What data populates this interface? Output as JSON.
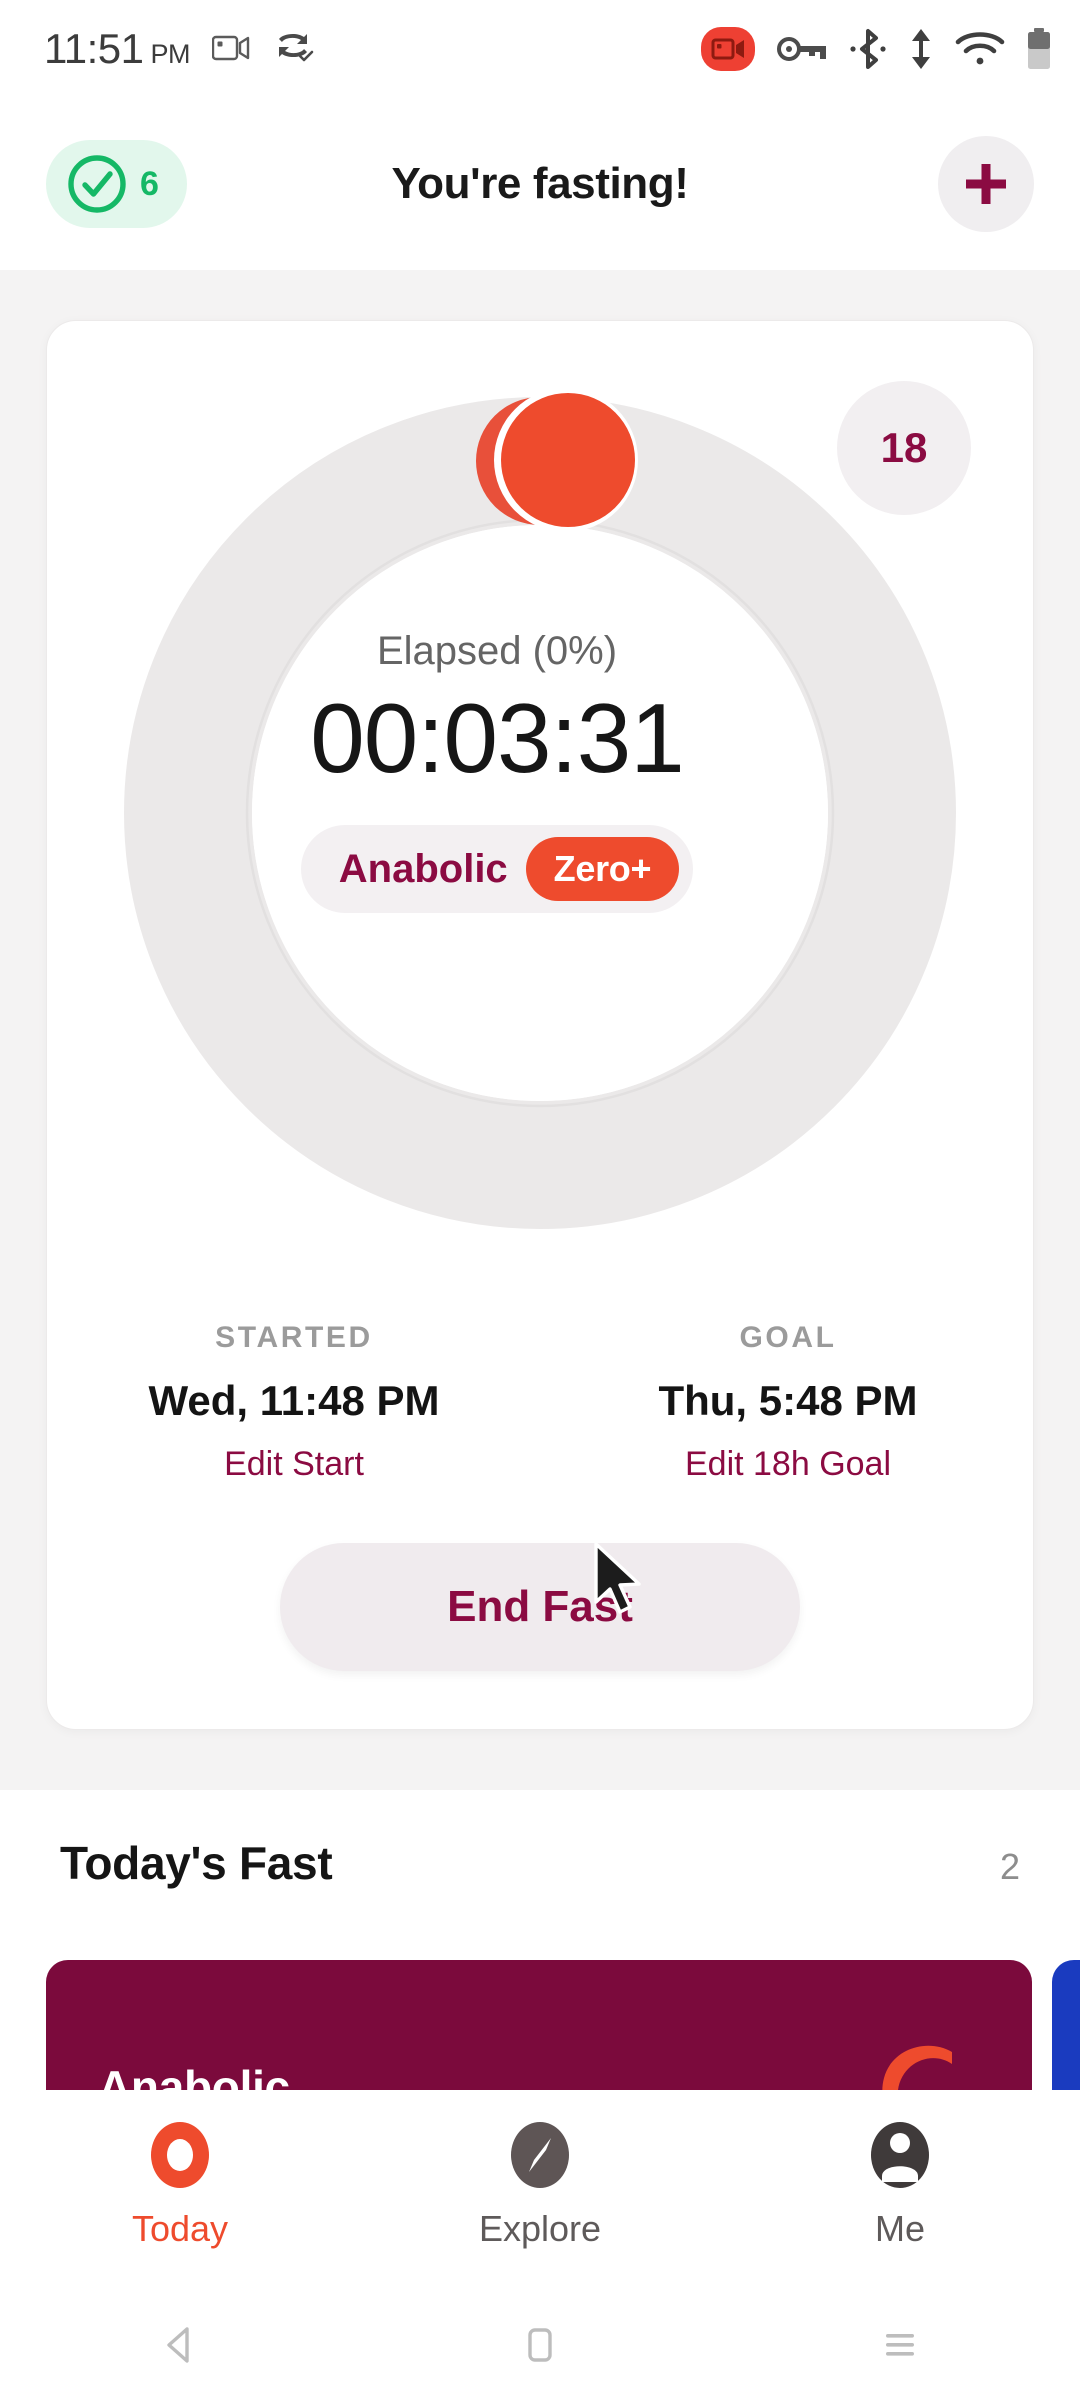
{
  "status_bar": {
    "time": "11:51",
    "ampm": "PM",
    "left_icons": [
      "video-call-icon",
      "edge-sync-icon"
    ],
    "right_icons": [
      "screen-record-icon",
      "vpn-key-icon",
      "bluetooth-icon",
      "data-transfer-icon",
      "wifi-icon",
      "battery-icon"
    ]
  },
  "header": {
    "streak_count": "6",
    "streak_icon": "check-circle-icon",
    "title": "You're fasting!",
    "add_icon": "plus-icon"
  },
  "timer": {
    "badge": "18",
    "elapsed_label": "Elapsed (0%)",
    "elapsed_time": "00:03:31",
    "stage_name": "Anabolic",
    "stage_badge": "Zero+",
    "progress_percent": 0
  },
  "stats": {
    "started": {
      "title": "STARTED",
      "value": "Wed, 11:48 PM",
      "edit": "Edit Start"
    },
    "goal": {
      "title": "GOAL",
      "value": "Thu, 5:48 PM",
      "edit": "Edit 18h Goal"
    }
  },
  "actions": {
    "end_fast": "End Fast"
  },
  "today": {
    "title": "Today's Fast",
    "count": "2",
    "cards": [
      {
        "label": "Anabolic",
        "color": "#7b0a3c",
        "glyph": "flame-glyph"
      },
      {
        "label": "",
        "color": "#1a3bbf",
        "glyph": ""
      }
    ]
  },
  "bottom_nav": {
    "items": [
      {
        "label": "Today",
        "icon": "ring-icon",
        "active": true
      },
      {
        "label": "Explore",
        "icon": "compass-icon",
        "active": false
      },
      {
        "label": "Me",
        "icon": "person-icon",
        "active": false
      }
    ]
  },
  "android_nav": {
    "back": "back-triangle-icon",
    "home": "home-square-icon",
    "recents": "recents-lines-icon"
  },
  "colors": {
    "accent_red": "#ee4b2d",
    "brand_magenta": "#8b0b42",
    "card_magenta": "#7b0a3c",
    "card_blue": "#1a3bbf",
    "streak_green": "#15b866",
    "ring_track": "#ebe9e9"
  }
}
